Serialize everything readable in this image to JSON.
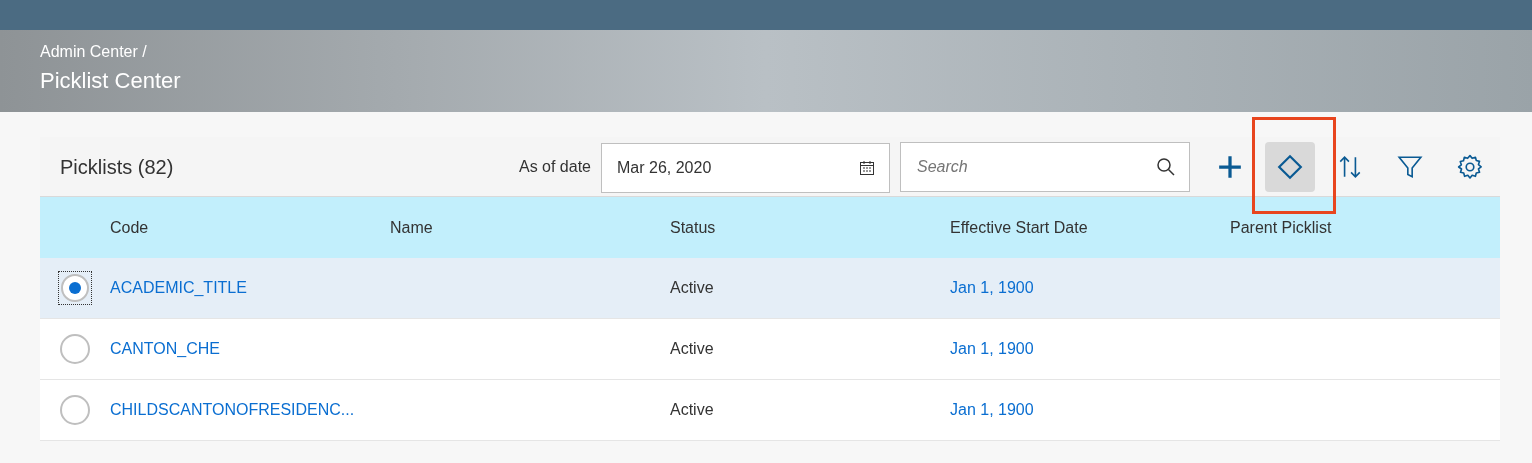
{
  "breadcrumb": "Admin Center /",
  "page_title": "Picklist Center",
  "toolbar": {
    "title": "Picklists (82)",
    "date_label": "As of date",
    "date_value": "Mar 26, 2020",
    "search": {
      "placeholder": "Search"
    },
    "buttons": [
      {
        "highlighted": false
      },
      {
        "highlighted": true
      },
      {
        "highlighted": false
      },
      {
        "highlighted": false
      },
      {
        "highlighted": false
      }
    ]
  },
  "table": {
    "columns": [
      "Code",
      "Name",
      "Status",
      "Effective Start Date",
      "Parent Picklist"
    ],
    "rows": [
      {
        "selected": true,
        "code": "ACADEMIC_TITLE",
        "status": "Active",
        "effective_start_date": "Jan 1, 1900"
      },
      {
        "selected": false,
        "code": "CANTON_CHE",
        "status": "Active",
        "effective_start_date": "Jan 1, 1900"
      },
      {
        "selected": false,
        "code": "CHILDSCANTONOFRESIDENC...",
        "status": "Active",
        "effective_start_date": "Jan 1, 1900"
      }
    ]
  }
}
